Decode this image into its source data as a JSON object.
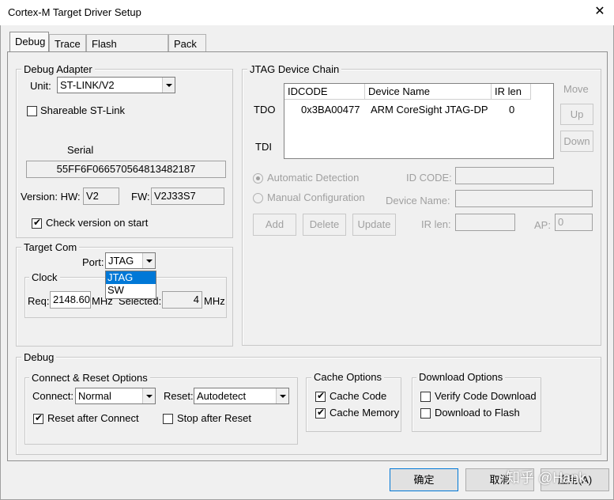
{
  "window": {
    "title": "Cortex-M Target Driver Setup",
    "close_glyph": "✕"
  },
  "tabs": [
    "Debug",
    "Trace",
    "Flash Download",
    "Pack"
  ],
  "debug_adapter": {
    "legend": "Debug Adapter",
    "unit_label": "Unit:",
    "unit_value": "ST-LINK/V2",
    "shareable_label": "Shareable ST-Link",
    "serial_label": "Serial",
    "serial_value": "55FF6F066570564813482187",
    "version_label": "Version: HW:",
    "hw_value": "V2",
    "fw_label": "FW:",
    "fw_value": "V2J33S7",
    "check_version_label": "Check version on start"
  },
  "target_com": {
    "legend": "Target Com",
    "port_label": "Port:",
    "port_value": "JTAG",
    "port_options": [
      "JTAG",
      "SW"
    ],
    "clock_legend": "Clock",
    "req_label": "Req:",
    "req_value": "2148.60",
    "mhz": "MHz",
    "selected_label": "Selected:",
    "selected_value": "4",
    "mhz2": "MHz"
  },
  "jtag": {
    "legend": "JTAG Device Chain",
    "tdo_label": "TDO",
    "tdi_label": "TDI",
    "headers": [
      "IDCODE",
      "Device Name",
      "IR len"
    ],
    "rows": [
      {
        "idcode": "0x3BA00477",
        "name": "ARM CoreSight JTAG-DP",
        "irlen": "0"
      }
    ],
    "move_label": "Move",
    "up_label": "Up",
    "down_label": "Down",
    "auto_label": "Automatic Detection",
    "manual_label": "Manual Configuration",
    "id_code_label": "ID CODE:",
    "device_name_label": "Device Name:",
    "ir_len_label": "IR len:",
    "ap_label": "AP:",
    "ap_value": "0",
    "add_label": "Add",
    "delete_label": "Delete",
    "update_label": "Update"
  },
  "debug": {
    "legend": "Debug",
    "connect_reset_legend": "Connect & Reset Options",
    "connect_label": "Connect:",
    "connect_value": "Normal",
    "reset_label": "Reset:",
    "reset_value": "Autodetect",
    "reset_after_connect": "Reset after Connect",
    "stop_after_reset": "Stop after Reset",
    "cache_legend": "Cache Options",
    "cache_code": "Cache Code",
    "cache_memory": "Cache Memory",
    "download_legend": "Download Options",
    "verify_code": "Verify Code Download",
    "download_flash": "Download to Flash"
  },
  "footer": {
    "ok_label": "确定",
    "cancel_label": "取消",
    "apply_label": "应用(A)"
  },
  "watermark": "知乎 @Hank"
}
